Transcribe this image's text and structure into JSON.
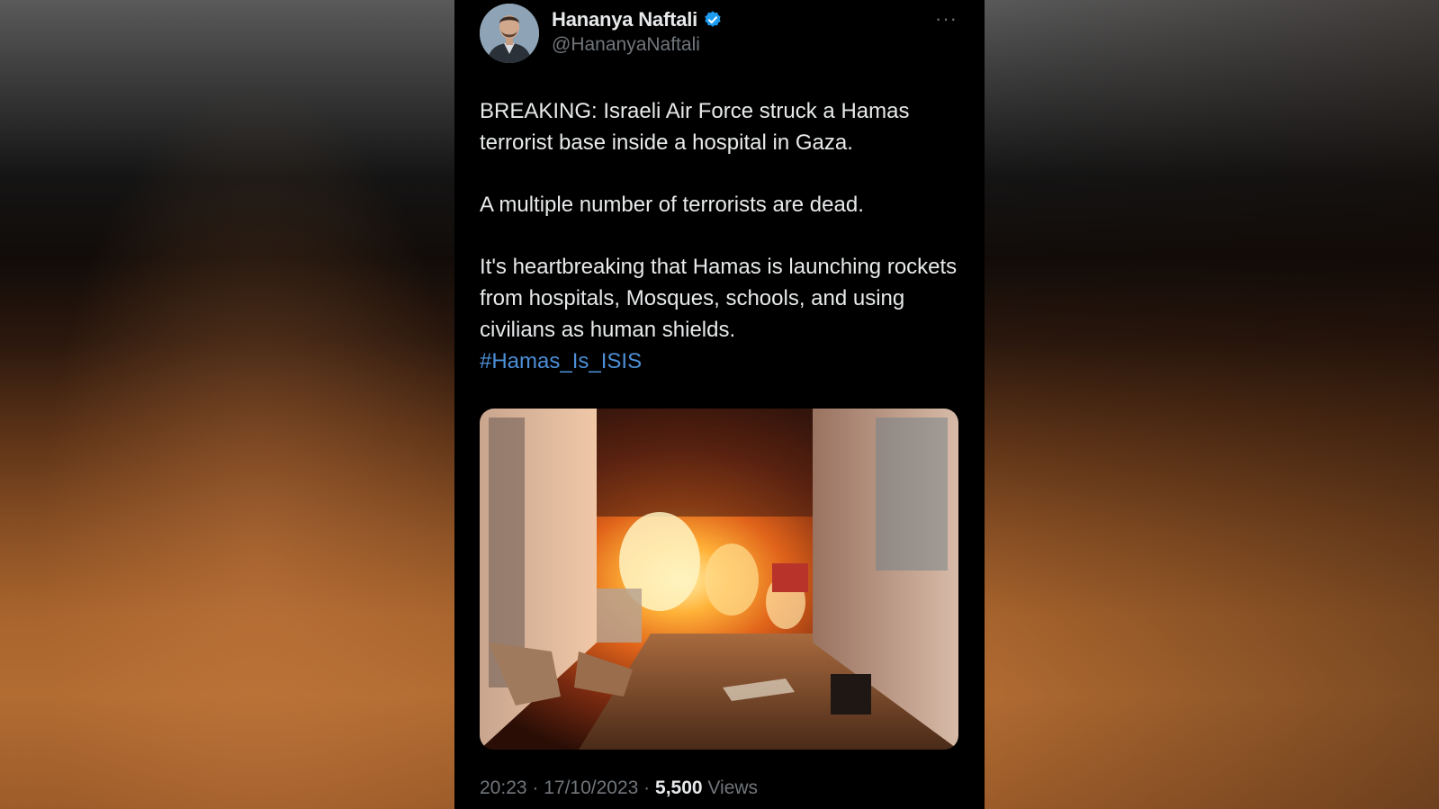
{
  "tweet": {
    "author": {
      "name": "Hananya Naftali",
      "handle": "@HananyaNaftali",
      "verified": true,
      "verified_color": "#1d9bf0"
    },
    "more_icon": "more-dots-icon",
    "text": {
      "paragraph_1": "BREAKING: Israeli Air Force struck a Hamas terrorist base inside a hospital in Gaza.",
      "paragraph_2": "A multiple number of terrorists are dead.",
      "paragraph_3": "It's heartbreaking that Hamas is launching rockets from hospitals, Mosques, schools, and using civilians as human shields.",
      "hashtag": "#Hamas_Is_ISIS"
    },
    "meta": {
      "time": "20:23",
      "separator": " · ",
      "date": "17/10/2023",
      "views_count": "5,500",
      "views_label": "Views"
    }
  },
  "colors": {
    "card_background": "#000000",
    "text_primary": "#e7e9ea",
    "text_secondary": "#71767b",
    "link": "#4c8fd6"
  }
}
